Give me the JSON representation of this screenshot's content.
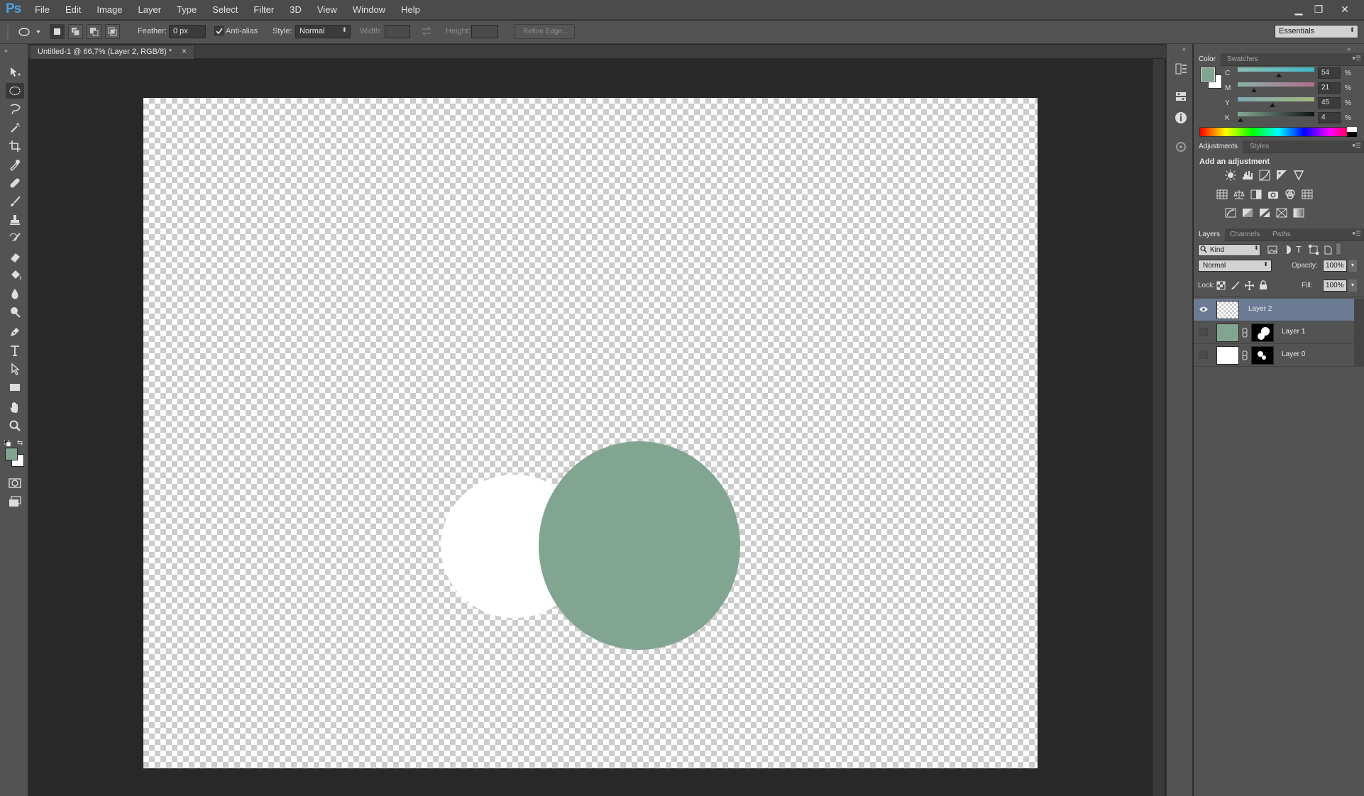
{
  "app": {
    "logo": "Ps"
  },
  "menu": [
    "File",
    "Edit",
    "Image",
    "Layer",
    "Type",
    "Select",
    "Filter",
    "3D",
    "View",
    "Window",
    "Help"
  ],
  "window_controls": {
    "minimize": "▁",
    "restore": "❐",
    "close": "✕"
  },
  "options_bar": {
    "feather_label": "Feather:",
    "feather_value": "0 px",
    "antialias_label": "Anti-alias",
    "antialias_checked": true,
    "style_label": "Style:",
    "style_value": "Normal",
    "width_label": "Width:",
    "height_label": "Height:",
    "refine_edge_label": "Refine Edge...",
    "workspace_value": "Essentials"
  },
  "document": {
    "tab_title": "Untitled-1 @ 66,7% (Layer 2, RGB/8) *",
    "tab_close": "×",
    "shapes_colors": {
      "white_circle": "#ffffff",
      "green_circle": "#82a592"
    }
  },
  "tools": [
    "move-tool",
    "elliptical-marquee-tool",
    "lasso-tool",
    "quick-selection-tool",
    "crop-tool",
    "eyedropper-tool",
    "spot-healing-tool",
    "brush-tool",
    "clone-stamp-tool",
    "history-brush-tool",
    "eraser-tool",
    "paint-bucket-tool",
    "blur-tool",
    "dodge-tool",
    "pen-tool",
    "type-tool",
    "path-selection-tool",
    "rectangle-tool",
    "hand-tool",
    "zoom-tool"
  ],
  "swatches": {
    "foreground": "#82a592",
    "background": "#ffffff"
  },
  "color_panel": {
    "tabs": [
      "Color",
      "Swatches"
    ],
    "channels": [
      {
        "label": "C",
        "value": "54",
        "unit": "%",
        "fraction": 0.54
      },
      {
        "label": "M",
        "value": "21",
        "unit": "%",
        "fraction": 0.21
      },
      {
        "label": "Y",
        "value": "45",
        "unit": "%",
        "fraction": 0.45
      },
      {
        "label": "K",
        "value": "4",
        "unit": "%",
        "fraction": 0.04
      }
    ]
  },
  "adjustments_panel": {
    "tabs": [
      "Adjustments",
      "Styles"
    ],
    "heading": "Add an adjustment"
  },
  "layers_panel": {
    "tabs": [
      "Layers",
      "Channels",
      "Paths"
    ],
    "filter_kind": "Kind",
    "blend_mode": "Normal",
    "opacity_label": "Opacity:",
    "opacity_value": "100%",
    "lock_label": "Lock:",
    "fill_label": "Fill:",
    "fill_value": "100%",
    "layers": [
      {
        "name": "Layer 2",
        "selected": true,
        "visible": true
      },
      {
        "name": "Layer 1",
        "selected": false,
        "visible": false
      },
      {
        "name": "Layer 0",
        "selected": false,
        "visible": false
      }
    ]
  }
}
